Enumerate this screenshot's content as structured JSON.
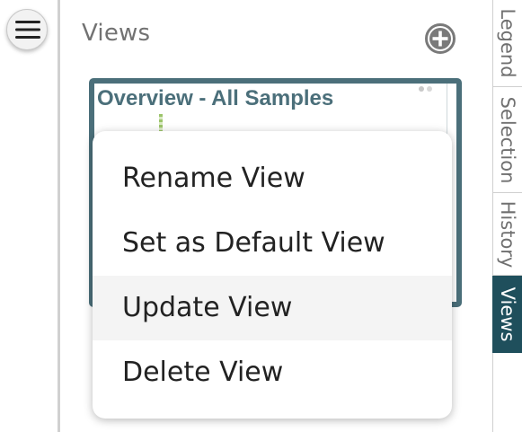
{
  "panel": {
    "title": "Views",
    "add_icon": "plus-circle-icon"
  },
  "hamburger_icon": "hamburger-menu-icon",
  "view_card": {
    "title": "Overview - All Samples"
  },
  "context_menu": {
    "items": [
      {
        "label": "Rename View"
      },
      {
        "label": "Set as Default View"
      },
      {
        "label": "Update View",
        "hovered": true
      },
      {
        "label": "Delete View"
      }
    ]
  },
  "side_tabs": [
    {
      "label": "Legend"
    },
    {
      "label": "Selection"
    },
    {
      "label": "History"
    },
    {
      "label": "Views",
      "active": true
    }
  ],
  "colors": {
    "accent": "#4b6f7a",
    "active_tab": "#1f4f5c",
    "hover_bg": "#f4f4f4"
  }
}
